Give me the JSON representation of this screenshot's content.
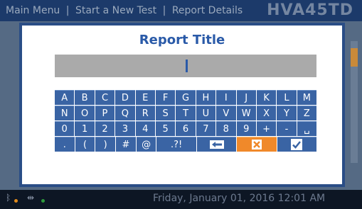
{
  "background": {
    "breadcrumbs": [
      "Main Menu",
      "|",
      "Start a New Test",
      "|",
      "Report Details"
    ],
    "model": "HVA45TD",
    "status": {
      "datetime": "Friday, January 01, 2016 12:01 AM",
      "icons": [
        "bluetooth-icon",
        "usb-icon"
      ],
      "dot_colors": [
        "#e08a1c",
        "#2e9a3c"
      ]
    }
  },
  "dialog": {
    "title": "Report Title",
    "input_value": ""
  },
  "keyboard": {
    "row1": [
      "A",
      "B",
      "C",
      "D",
      "E",
      "F",
      "G",
      "H",
      "I",
      "J",
      "K",
      "L",
      "M"
    ],
    "row2": [
      "N",
      "O",
      "P",
      "Q",
      "R",
      "S",
      "T",
      "U",
      "V",
      "W",
      "X",
      "Y",
      "Z"
    ],
    "row3": [
      "0",
      "1",
      "2",
      "3",
      "4",
      "5",
      "6",
      "7",
      "8",
      "9",
      "+",
      "-",
      "␣"
    ],
    "row4": [
      ".",
      "(",
      ")",
      "#",
      "@",
      ".?!"
    ],
    "backspace_icon": "backspace-arrow-icon",
    "clear_icon": "clear-x-icon",
    "enter_icon": "checkmark-icon",
    "colors": {
      "key": "#3a64a4",
      "clear": "#f0892a",
      "title": "#2a5aa8"
    }
  }
}
